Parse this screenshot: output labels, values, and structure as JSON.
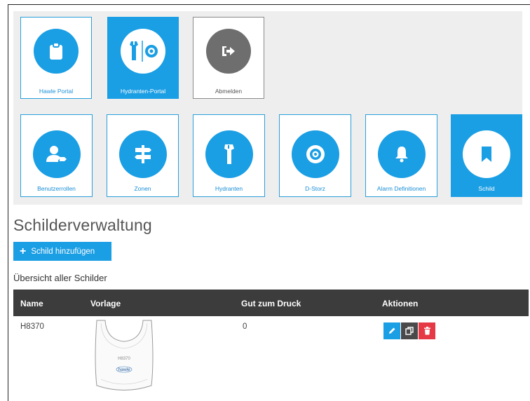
{
  "tiles_row1": [
    {
      "label": "Hawle Portal",
      "icon": "clipboard-icon"
    },
    {
      "label": "Hydranten-Portal",
      "icon": "hydrant-portal-icon"
    },
    {
      "label": "Abmelden",
      "icon": "logout-icon"
    }
  ],
  "tiles_row2": [
    {
      "label": "Benutzerrollen",
      "icon": "user-tag-icon"
    },
    {
      "label": "Zonen",
      "icon": "signpost-icon"
    },
    {
      "label": "Hydranten",
      "icon": "hydrant-icon"
    },
    {
      "label": "D-Storz",
      "icon": "coupling-icon"
    },
    {
      "label": "Alarm Definitionen",
      "icon": "bell-icon"
    },
    {
      "label": "Schild",
      "icon": "bookmark-icon"
    }
  ],
  "page": {
    "title": "Schilderverwaltung",
    "add_button": "Schild hinzufügen",
    "overview_heading": "Übersicht aller Schilder"
  },
  "table": {
    "headers": [
      "Name",
      "Vorlage",
      "Gut zum Druck",
      "Aktionen"
    ],
    "rows": [
      {
        "name": "H8370",
        "gut_zum_druck": "0",
        "thumbnail_text": {
          "code": "H8370",
          "brand": "hawle"
        }
      }
    ]
  },
  "colors": {
    "accent": "#1a9ee4",
    "header_bg": "#3c3c3c",
    "delete": "#e53945",
    "copy": "#4a4a4a",
    "logout_circle": "#6e6e6e"
  }
}
